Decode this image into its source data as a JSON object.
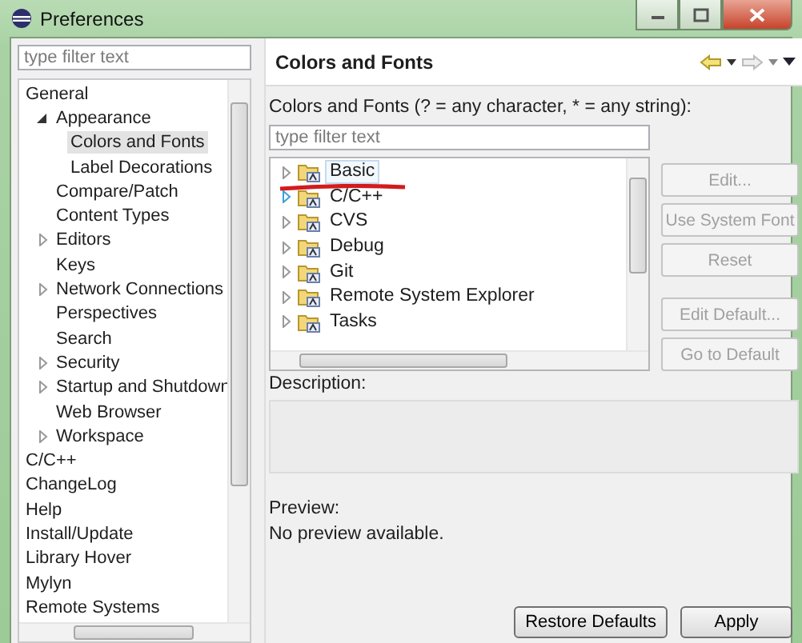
{
  "window": {
    "title": "Preferences"
  },
  "sidebar": {
    "filter_placeholder": "type filter text",
    "items": [
      {
        "label": "General",
        "selected": false,
        "children": [
          {
            "label": "Appearance",
            "selected": false,
            "expanded": true,
            "children": [
              {
                "label": "Colors and Fonts",
                "selected": true
              },
              {
                "label": "Label Decorations",
                "selected": false
              }
            ]
          },
          {
            "label": "Compare/Patch",
            "selected": false
          },
          {
            "label": "Content Types",
            "selected": false
          },
          {
            "label": "Editors",
            "selected": false,
            "expanded": false
          },
          {
            "label": "Keys",
            "selected": false
          },
          {
            "label": "Network Connections",
            "selected": false,
            "expanded": false
          },
          {
            "label": "Perspectives",
            "selected": false
          },
          {
            "label": "Search",
            "selected": false
          },
          {
            "label": "Security",
            "selected": false,
            "expanded": false
          },
          {
            "label": "Startup and Shutdown",
            "selected": false,
            "expanded": false
          },
          {
            "label": "Web Browser",
            "selected": false
          },
          {
            "label": "Workspace",
            "selected": false,
            "expanded": false
          }
        ]
      },
      {
        "label": "C/C++",
        "selected": false
      },
      {
        "label": "ChangeLog",
        "selected": false
      },
      {
        "label": "Help",
        "selected": false
      },
      {
        "label": "Install/Update",
        "selected": false
      },
      {
        "label": "Library Hover",
        "selected": false
      },
      {
        "label": "Mylyn",
        "selected": false
      },
      {
        "label": "Remote Systems",
        "selected": false
      }
    ]
  },
  "page": {
    "title": "Colors and Fonts",
    "filter_label": "Colors and Fonts (? = any character, * = any string):",
    "filter_placeholder": "type filter text",
    "items": [
      {
        "label": "Basic",
        "selected": true,
        "expanded": false
      },
      {
        "label": "C/C++",
        "selected": false,
        "expanded": false
      },
      {
        "label": "CVS",
        "selected": false,
        "expanded": false
      },
      {
        "label": "Debug",
        "selected": false,
        "expanded": false
      },
      {
        "label": "Git",
        "selected": false,
        "expanded": false
      },
      {
        "label": "Remote System Explorer",
        "selected": false,
        "expanded": false
      },
      {
        "label": "Tasks",
        "selected": false,
        "expanded": false
      }
    ],
    "buttons": [
      {
        "label": "Edit...",
        "disabled": true
      },
      {
        "label": "Use System Font",
        "disabled": true
      },
      {
        "label": "Reset",
        "disabled": true
      },
      {
        "label": "Edit Default...",
        "disabled": true
      },
      {
        "label": "Go to Default",
        "disabled": true
      }
    ],
    "description_label": "Description:",
    "preview_label": "Preview:",
    "preview_text": "No preview available."
  },
  "buttons": [
    {
      "label": "Restore Defaults"
    },
    {
      "label": "Apply"
    }
  ]
}
